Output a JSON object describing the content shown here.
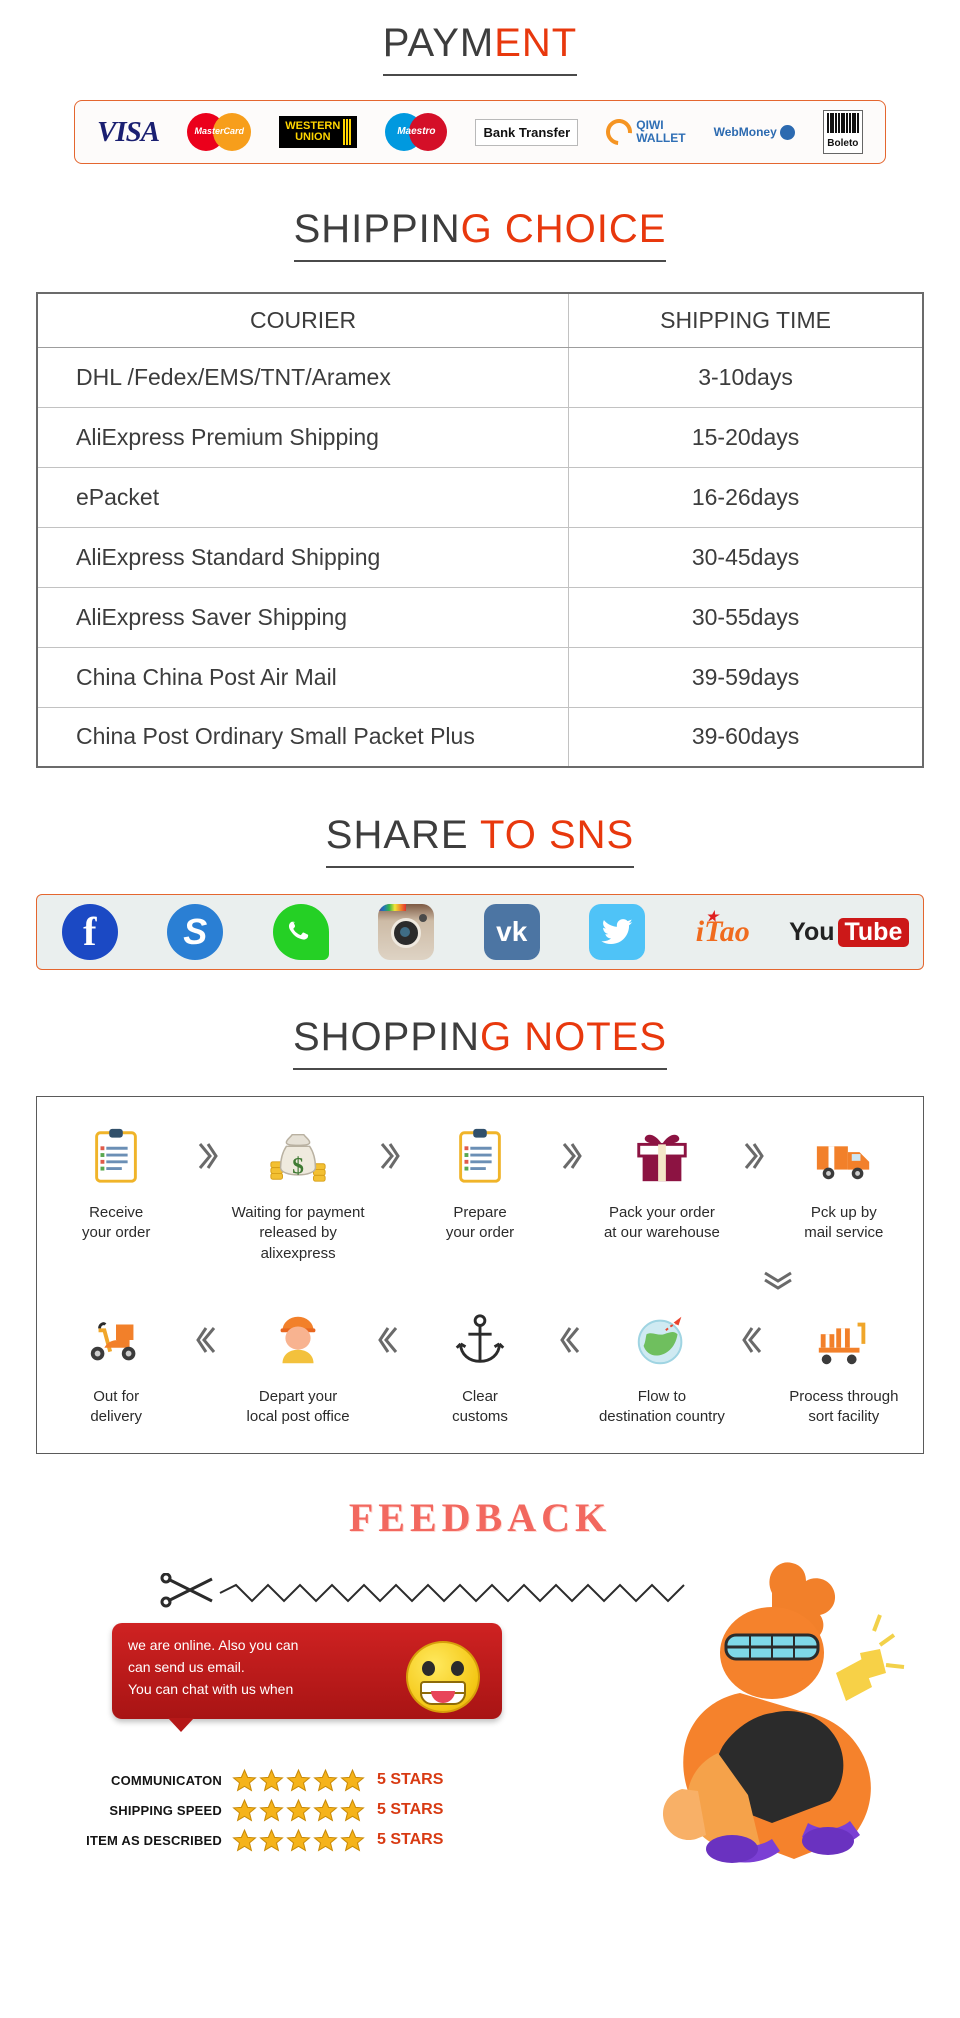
{
  "payment": {
    "title_dark": "PAYM",
    "title_red": "ENT",
    "methods": [
      {
        "name": "visa-logo",
        "label": "VISA"
      },
      {
        "name": "mastercard-logo",
        "label": "MasterCard"
      },
      {
        "name": "western-union-logo",
        "label1": "WESTERN",
        "label2": "UNION"
      },
      {
        "name": "maestro-logo",
        "label": "Maestro"
      },
      {
        "name": "bank-transfer-logo",
        "label": "Bank Transfer"
      },
      {
        "name": "qiwi-wallet-logo",
        "label1": "QIWI",
        "label2": "WALLET"
      },
      {
        "name": "webmoney-logo",
        "label": "WebMoney"
      },
      {
        "name": "boleto-logo",
        "label": "Boleto"
      }
    ]
  },
  "shipping": {
    "title_dark": "SHIPPIN",
    "title_red": "G CHOICE",
    "columns": [
      "COURIER",
      "SHIPPING TIME"
    ],
    "rows": [
      {
        "courier": "DHL /Fedex/EMS/TNT/Aramex",
        "time": "3-10days"
      },
      {
        "courier": "AliExpress Premium Shipping",
        "time": "15-20days"
      },
      {
        "courier": "ePacket",
        "time": "16-26days"
      },
      {
        "courier": "AliExpress Standard Shipping",
        "time": "30-45days"
      },
      {
        "courier": "AliExpress Saver Shipping",
        "time": "30-55days"
      },
      {
        "courier": "China China Post Air Mail",
        "time": "39-59days"
      },
      {
        "courier": "China Post Ordinary Small Packet Plus",
        "time": "39-60days"
      }
    ]
  },
  "sns": {
    "title_dark": "SHARE ",
    "title_red": "TO SNS",
    "icons": [
      {
        "name": "facebook-icon",
        "label": "f"
      },
      {
        "name": "skype-icon",
        "label": "S"
      },
      {
        "name": "whatsapp-icon",
        "label": "WhatsApp"
      },
      {
        "name": "instagram-icon",
        "label": "Instagram"
      },
      {
        "name": "vk-icon",
        "label": "vk"
      },
      {
        "name": "twitter-icon",
        "label": "Twitter"
      },
      {
        "name": "itao-icon",
        "label": "iTao"
      },
      {
        "name": "youtube-icon",
        "label1": "You",
        "label2": "Tube"
      }
    ]
  },
  "notes": {
    "title_dark": "SHOPPIN",
    "title_red": "G NOTES",
    "row1": [
      {
        "icon": "clipboard-icon",
        "label": "Receive\nyour order"
      },
      {
        "icon": "money-bag-icon",
        "label": "Waiting for payment\nreleased by alixexpress"
      },
      {
        "icon": "clipboard-icon",
        "label": "Prepare\nyour order"
      },
      {
        "icon": "gift-box-icon",
        "label": "Pack your order\nat our warehouse"
      },
      {
        "icon": "delivery-truck-icon",
        "label": "Pck up by\nmail service"
      }
    ],
    "row2": [
      {
        "icon": "scooter-icon",
        "label": "Out for\ndelivery"
      },
      {
        "icon": "postman-icon",
        "label": "Depart your\nlocal post office"
      },
      {
        "icon": "anchor-icon",
        "label": "Clear\ncustoms"
      },
      {
        "icon": "globe-icon",
        "label": "Flow to\ndestination country"
      },
      {
        "icon": "sort-facility-icon",
        "label": "Process through\nsort facility"
      }
    ]
  },
  "feedback": {
    "title": "FEEDBACK",
    "bubble_lines": [
      "we are online. Also you can",
      "can send us email.",
      "You can chat with us when"
    ],
    "ratings": [
      {
        "label": "COMMUNICATON",
        "stars": 5,
        "value": "5 STARS"
      },
      {
        "label": "SHIPPING SPEED",
        "stars": 5,
        "value": "5 STARS"
      },
      {
        "label": "ITEM AS DESCRIBED",
        "stars": 5,
        "value": "5 STARS"
      }
    ],
    "accent_color": "#d83a12",
    "title_color": "#f2685f"
  }
}
